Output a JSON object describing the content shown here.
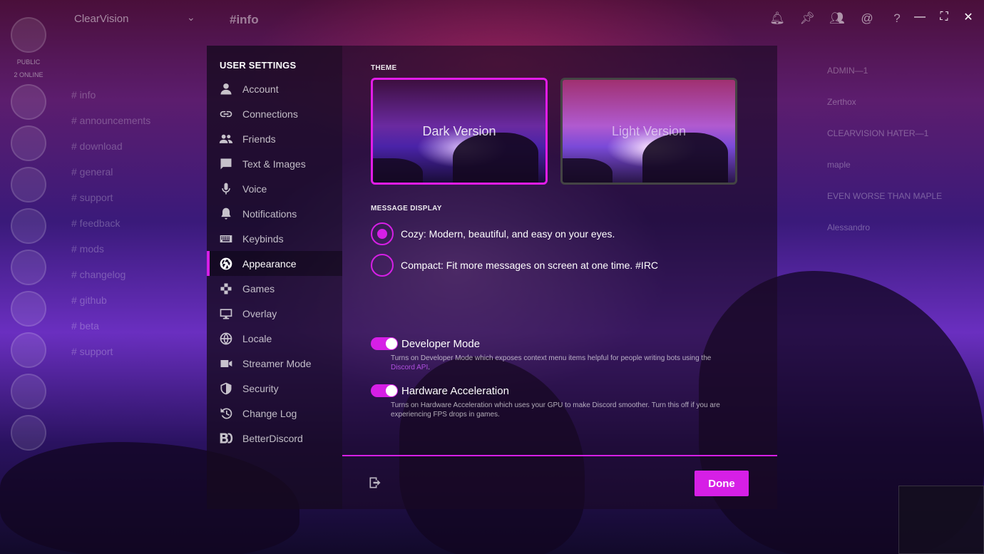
{
  "background": {
    "server_name": "ClearVision",
    "channel_title": "#info",
    "guild_labels": [
      "PUBLIC",
      "2 ONLINE"
    ],
    "channels": [
      "# info",
      "# announcements",
      "# download",
      "# general",
      "# support",
      "# feedback",
      "# mods",
      "# changelog",
      "# github",
      "# beta",
      "# support"
    ],
    "members": [
      "ADMIN—1",
      "Zerthox",
      "CLEARVISION HATER—1",
      "maple",
      "EVEN WORSE THAN MAPLE",
      "Alessandro"
    ]
  },
  "settings": {
    "header": "USER SETTINGS",
    "items": [
      {
        "label": "Account",
        "icon": "user-icon"
      },
      {
        "label": "Connections",
        "icon": "link-icon"
      },
      {
        "label": "Friends",
        "icon": "friends-icon"
      },
      {
        "label": "Text & Images",
        "icon": "chat-icon"
      },
      {
        "label": "Voice",
        "icon": "microphone-icon"
      },
      {
        "label": "Notifications",
        "icon": "bell-icon"
      },
      {
        "label": "Keybinds",
        "icon": "keyboard-icon"
      },
      {
        "label": "Appearance",
        "icon": "aperture-icon",
        "active": true
      },
      {
        "label": "Games",
        "icon": "gamepad-icon"
      },
      {
        "label": "Overlay",
        "icon": "monitor-icon"
      },
      {
        "label": "Locale",
        "icon": "globe-icon"
      },
      {
        "label": "Streamer Mode",
        "icon": "camera-icon"
      },
      {
        "label": "Security",
        "icon": "shield-icon"
      },
      {
        "label": "Change Log",
        "icon": "history-icon"
      },
      {
        "label": "BetterDiscord",
        "icon": "betterdiscord-icon"
      }
    ]
  },
  "appearance": {
    "theme_title": "THEME",
    "themes": [
      {
        "label": "Dark Version",
        "selected": true
      },
      {
        "label": "Light Version",
        "selected": false
      }
    ],
    "message_display_title": "MESSAGE DISPLAY",
    "message_display": [
      {
        "label": "Cozy: Modern, beautiful, and easy on your eyes.",
        "checked": true
      },
      {
        "label": "Compact: Fit more messages on screen at one time. #IRC",
        "checked": false
      }
    ],
    "developer_mode": {
      "label": "Developer Mode",
      "enabled": true,
      "desc": "Turns on Developer Mode which exposes context menu items helpful for people writing bots using the",
      "link": "Discord API",
      "link_suffix": "."
    },
    "hardware_acceleration": {
      "label": "Hardware Acceleration",
      "enabled": true,
      "desc": "Turns on Hardware Acceleration which uses your GPU to make Discord smoother. Turn this off if you are experiencing FPS drops in games."
    }
  },
  "footer": {
    "done_label": "Done"
  },
  "colors": {
    "accent": "#d61fe6"
  }
}
